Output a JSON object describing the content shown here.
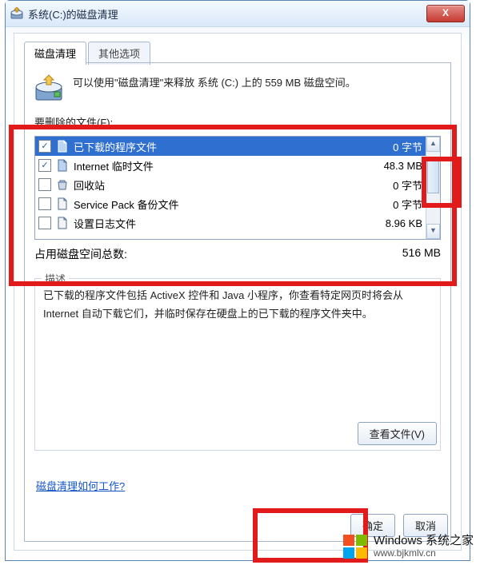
{
  "window": {
    "title": "系统(C:)的磁盘清理",
    "close_glyph": "X"
  },
  "tabs": {
    "active": "磁盘清理",
    "inactive": "其他选项"
  },
  "intro": "可以使用\"磁盘清理\"来释放 系统 (C:) 上的 559 MB 磁盘空间。",
  "delete_label": "要删除的文件(F):",
  "files": [
    {
      "checked": true,
      "selected": true,
      "icon": "file-blue",
      "name": "已下载的程序文件",
      "size": "0 字节"
    },
    {
      "checked": true,
      "selected": false,
      "icon": "file-blue",
      "name": "Internet 临时文件",
      "size": "48.3 MB"
    },
    {
      "checked": false,
      "selected": false,
      "icon": "recycle",
      "name": "回收站",
      "size": "0 字节"
    },
    {
      "checked": false,
      "selected": false,
      "icon": "file-plain",
      "name": "Service Pack 备份文件",
      "size": "0 字节"
    },
    {
      "checked": false,
      "selected": false,
      "icon": "file-plain",
      "name": "设置日志文件",
      "size": "8.96 KB"
    }
  ],
  "total": {
    "label": "占用磁盘空间总数:",
    "value": "516 MB"
  },
  "group_title": "描述",
  "description": "已下载的程序文件包括 ActiveX 控件和 Java 小程序，你查看特定网页时将会从 Internet 自动下载它们，并临时保存在硬盘上的已下载的程序文件夹中。",
  "view_files_btn": "查看文件(V)",
  "how_link": "磁盘清理如何工作?",
  "ok_btn": "确定",
  "cancel_btn": "取消",
  "watermark": {
    "cn": "Windows 系统之家",
    "url": "www.bjkmlv.cn"
  }
}
